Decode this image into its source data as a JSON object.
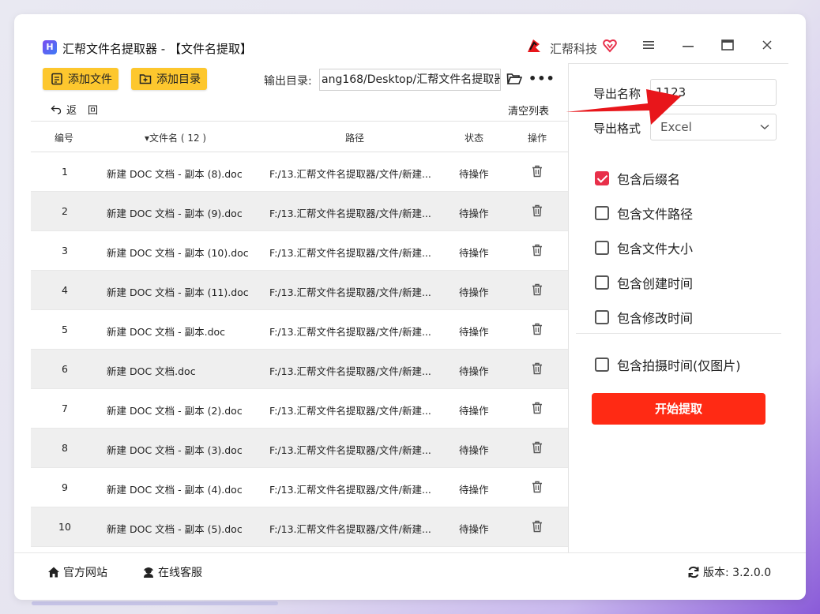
{
  "window": {
    "title": "汇帮文件名提取器 - 【文件名提取】",
    "brand": "汇帮科技"
  },
  "toolbar": {
    "add_file": "添加文件",
    "add_dir": "添加目录",
    "output_label": "输出目录:",
    "output_path": "ang168/Desktop/汇帮文件名提取器",
    "more": "•••",
    "back": "返回",
    "clear": "清空列表"
  },
  "table": {
    "headers": {
      "num": "编号",
      "name": "▾文件名 ( 12 )",
      "path": "路径",
      "status": "状态",
      "op": "操作"
    },
    "rows": [
      {
        "num": "1",
        "name": "新建 DOC 文档 - 副本 (8).doc",
        "path": "F:/13.汇帮文件名提取器/文件/新建...",
        "status": "待操作"
      },
      {
        "num": "2",
        "name": "新建 DOC 文档 - 副本 (9).doc",
        "path": "F:/13.汇帮文件名提取器/文件/新建...",
        "status": "待操作"
      },
      {
        "num": "3",
        "name": "新建 DOC 文档 - 副本 (10).doc",
        "path": "F:/13.汇帮文件名提取器/文件/新建...",
        "status": "待操作"
      },
      {
        "num": "4",
        "name": "新建 DOC 文档 - 副本 (11).doc",
        "path": "F:/13.汇帮文件名提取器/文件/新建...",
        "status": "待操作"
      },
      {
        "num": "5",
        "name": "新建 DOC 文档 - 副本.doc",
        "path": "F:/13.汇帮文件名提取器/文件/新建...",
        "status": "待操作"
      },
      {
        "num": "6",
        "name": "新建 DOC 文档.doc",
        "path": "F:/13.汇帮文件名提取器/文件/新建...",
        "status": "待操作"
      },
      {
        "num": "7",
        "name": "新建 DOC 文档 - 副本 (2).doc",
        "path": "F:/13.汇帮文件名提取器/文件/新建...",
        "status": "待操作"
      },
      {
        "num": "8",
        "name": "新建 DOC 文档 - 副本 (3).doc",
        "path": "F:/13.汇帮文件名提取器/文件/新建...",
        "status": "待操作"
      },
      {
        "num": "9",
        "name": "新建 DOC 文档 - 副本 (4).doc",
        "path": "F:/13.汇帮文件名提取器/文件/新建...",
        "status": "待操作"
      },
      {
        "num": "10",
        "name": "新建 DOC 文档 - 副本 (5).doc",
        "path": "F:/13.汇帮文件名提取器/文件/新建...",
        "status": "待操作"
      }
    ]
  },
  "panel": {
    "export_name_label": "导出名称",
    "export_name_value": "1123",
    "export_format_label": "导出格式",
    "export_format_value": "Excel",
    "options": [
      {
        "label": "包含后缀名",
        "checked": true
      },
      {
        "label": "包含文件路径",
        "checked": false
      },
      {
        "label": "包含文件大小",
        "checked": false
      },
      {
        "label": "包含创建时间",
        "checked": false
      },
      {
        "label": "包含修改时间",
        "checked": false
      },
      {
        "label": "包含拍摄时间(仅图片)",
        "checked": false
      }
    ],
    "start_button": "开始提取"
  },
  "footer": {
    "website": "官方网站",
    "support": "在线客服",
    "version": "版本: 3.2.0.0"
  },
  "colors": {
    "accent_yellow": "#fdc72e",
    "start_red": "#ff2a14",
    "checkbox_red": "#e8304a",
    "annotation_red": "#e8161b"
  }
}
